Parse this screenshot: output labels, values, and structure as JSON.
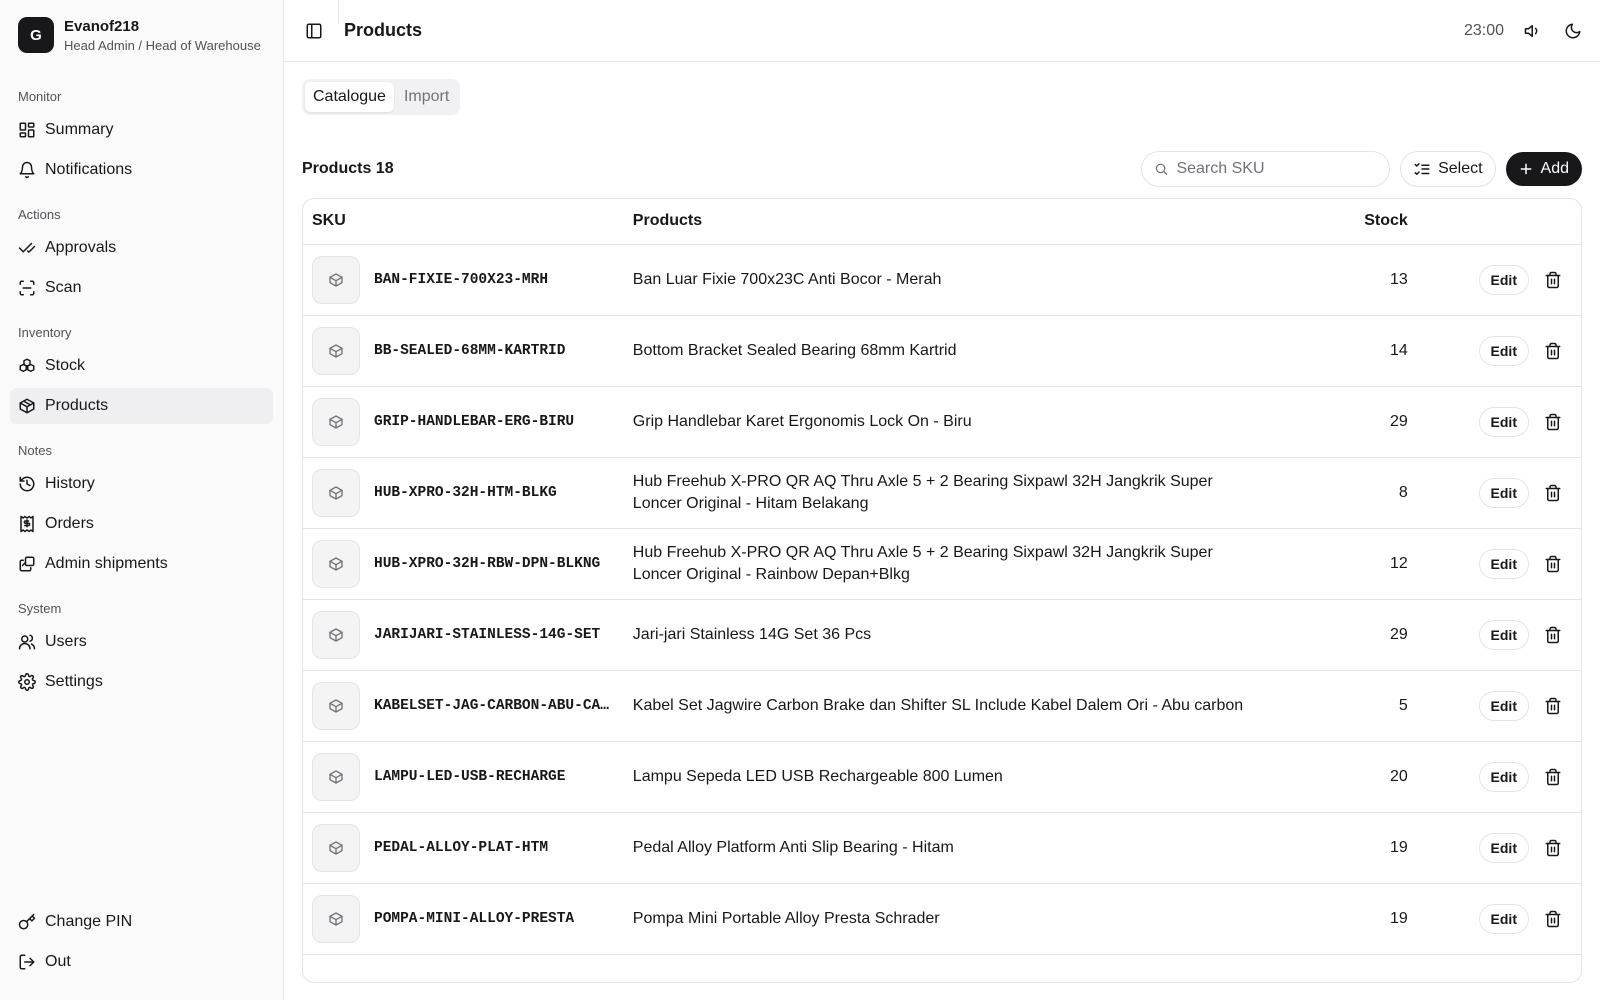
{
  "user": {
    "initial": "G",
    "name": "Evanof218",
    "role": "Head Admin / Head of Warehouse"
  },
  "sidebar": {
    "groups": [
      {
        "label": "Monitor",
        "items": [
          {
            "label": "Summary",
            "icon": "grid-icon"
          },
          {
            "label": "Notifications",
            "icon": "bell-icon"
          }
        ]
      },
      {
        "label": "Actions",
        "items": [
          {
            "label": "Approvals",
            "icon": "double-check-icon"
          },
          {
            "label": "Scan",
            "icon": "scan-icon"
          }
        ]
      },
      {
        "label": "Inventory",
        "items": [
          {
            "label": "Stock",
            "icon": "boxes-icon"
          },
          {
            "label": "Products",
            "icon": "package-icon",
            "active": true
          }
        ]
      },
      {
        "label": "Notes",
        "items": [
          {
            "label": "History",
            "icon": "history-icon"
          },
          {
            "label": "Orders",
            "icon": "receipt-icon"
          },
          {
            "label": "Admin shipments",
            "icon": "shipments-icon"
          }
        ]
      },
      {
        "label": "System",
        "items": [
          {
            "label": "Users",
            "icon": "users-icon"
          },
          {
            "label": "Settings",
            "icon": "gear-icon"
          }
        ]
      }
    ],
    "bottom": [
      {
        "label": "Change PIN",
        "icon": "key-icon"
      },
      {
        "label": "Out",
        "icon": "logout-icon"
      }
    ]
  },
  "header": {
    "title": "Products",
    "time": "23:00"
  },
  "tabs": [
    {
      "label": "Catalogue",
      "active": true
    },
    {
      "label": "Import",
      "active": false
    }
  ],
  "toolbar": {
    "count_label": "Products 18",
    "search_placeholder": "Search SKU",
    "select_label": "Select",
    "add_label": "Add"
  },
  "table": {
    "columns": [
      "SKU",
      "Products",
      "Stock"
    ],
    "edit_label": "Edit",
    "rows": [
      {
        "sku": "BAN-FIXIE-700X23-MRH",
        "product": "Ban Luar Fixie 700x23C Anti Bocor - Merah",
        "stock": "13"
      },
      {
        "sku": "BB-SEALED-68MM-KARTRID",
        "product": "Bottom Bracket Sealed Bearing 68mm Kartrid",
        "stock": "14"
      },
      {
        "sku": "GRIP-HANDLEBAR-ERG-BIRU",
        "product": "Grip Handlebar Karet Ergonomis Lock On - Biru",
        "stock": "29"
      },
      {
        "sku": "HUB-XPRO-32H-HTM-BLKG",
        "product": "Hub Freehub X-PRO QR AQ Thru Axle 5 + 2 Bearing Sixpawl 32H Jangkrik Super Loncer Original - Hitam Belakang",
        "stock": "8"
      },
      {
        "sku": "HUB-XPRO-32H-RBW-DPN-BLKNG",
        "product": "Hub Freehub X-PRO QR AQ Thru Axle 5 + 2 Bearing Sixpawl 32H Jangkrik Super Loncer Original - Rainbow Depan+Blkg",
        "stock": "12"
      },
      {
        "sku": "JARIJARI-STAINLESS-14G-SET",
        "product": "Jari-jari Stainless 14G Set 36 Pcs",
        "stock": "29"
      },
      {
        "sku": "KABELSET-JAG-CARBON-ABU-CARBON",
        "product": "Kabel Set Jagwire Carbon Brake dan Shifter SL Include Kabel Dalem Ori - Abu carbon",
        "stock": "5"
      },
      {
        "sku": "LAMPU-LED-USB-RECHARGE",
        "product": "Lampu Sepeda LED USB Rechargeable 800 Lumen",
        "stock": "20"
      },
      {
        "sku": "PEDAL-ALLOY-PLAT-HTM",
        "product": "Pedal Alloy Platform Anti Slip Bearing - Hitam",
        "stock": "19"
      },
      {
        "sku": "POMPA-MINI-ALLOY-PRESTA",
        "product": "Pompa Mini Portable Alloy Presta Schrader",
        "stock": "19"
      }
    ]
  }
}
